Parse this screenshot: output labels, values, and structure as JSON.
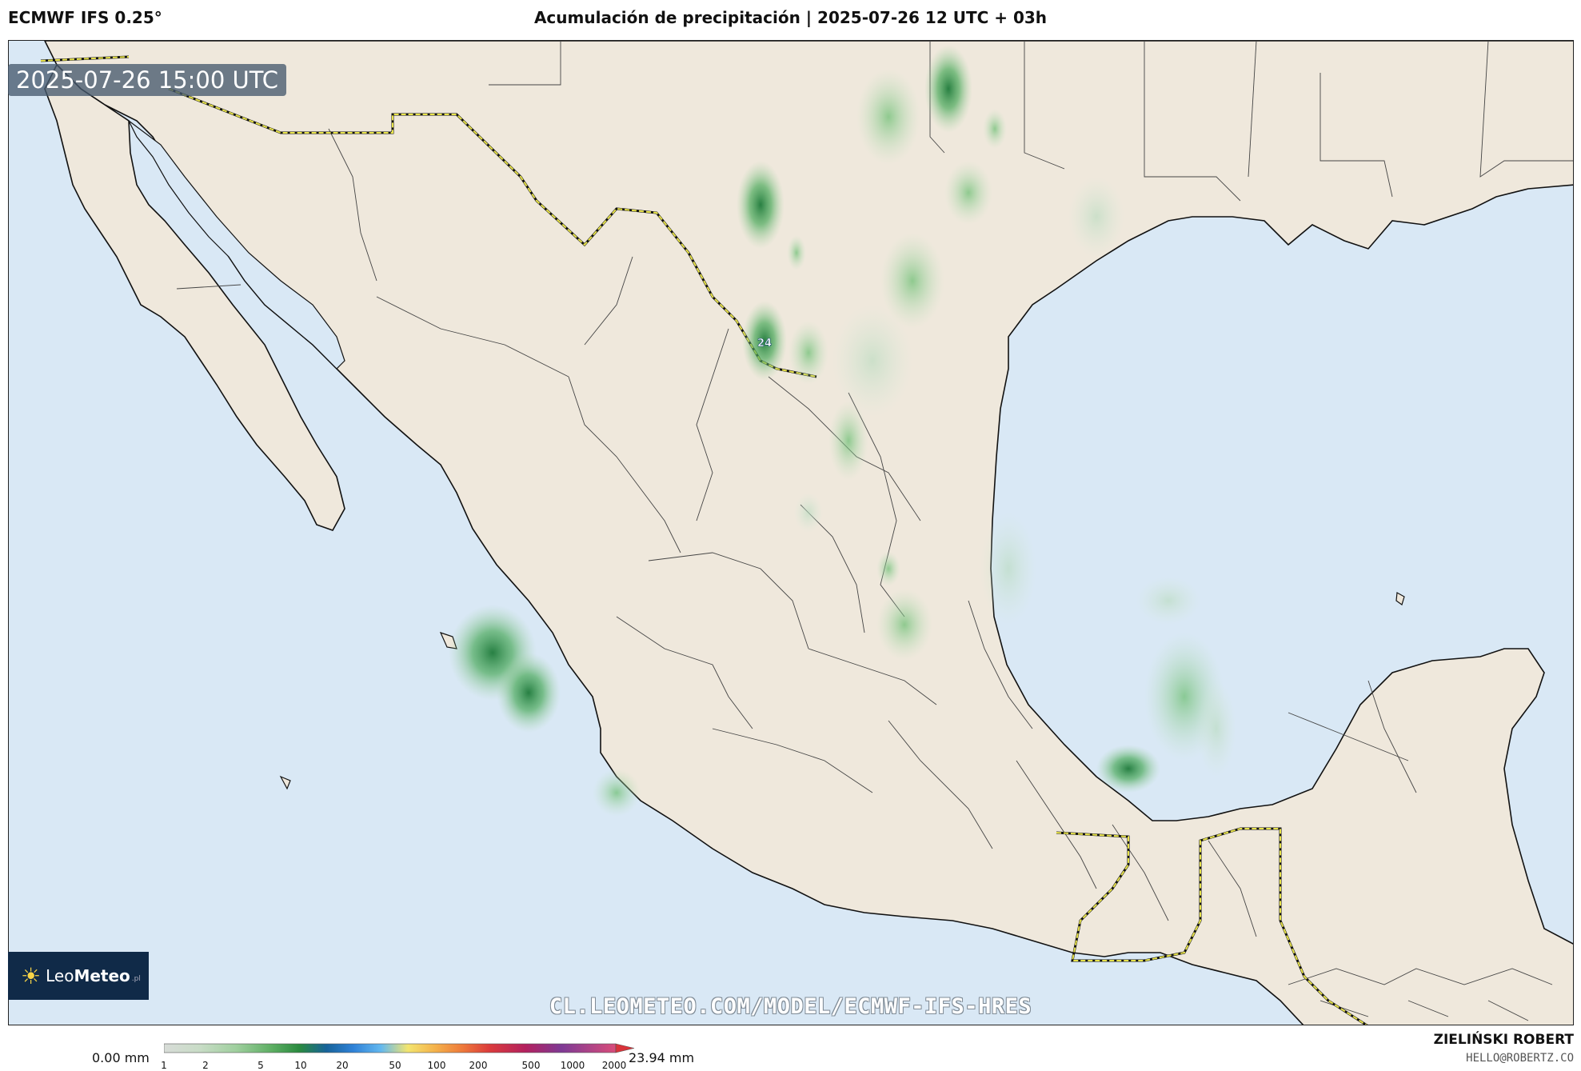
{
  "header": {
    "model": "ECMWF IFS 0.25°",
    "title": "Acumulación de precipitación | 2025-07-26 12 UTC + 03h"
  },
  "map": {
    "valid_time": "2025-07-26 15:00 UTC",
    "max_label": "24",
    "watermark": "CL.LEOMETEO.COM/MODEL/ECMWF-IFS-HRES",
    "colors": {
      "ocean": "#d9e8f5",
      "land": "#efe8dc",
      "border_national": "#e8e34a"
    }
  },
  "logo": {
    "text_light": "Leo",
    "text_bold": "Meteo",
    "suffix": ".pl",
    "icon": "sun-icon"
  },
  "legend": {
    "min_label": "0.00 mm",
    "max_label": "23.94 mm",
    "ticks": [
      "1",
      "2",
      "5",
      "10",
      "20",
      "50",
      "100",
      "200",
      "500",
      "1000",
      "2000"
    ]
  },
  "credits": {
    "author": "ZIELIŃSKI ROBERT",
    "email": "HELLO@ROBERTZ.CO"
  }
}
